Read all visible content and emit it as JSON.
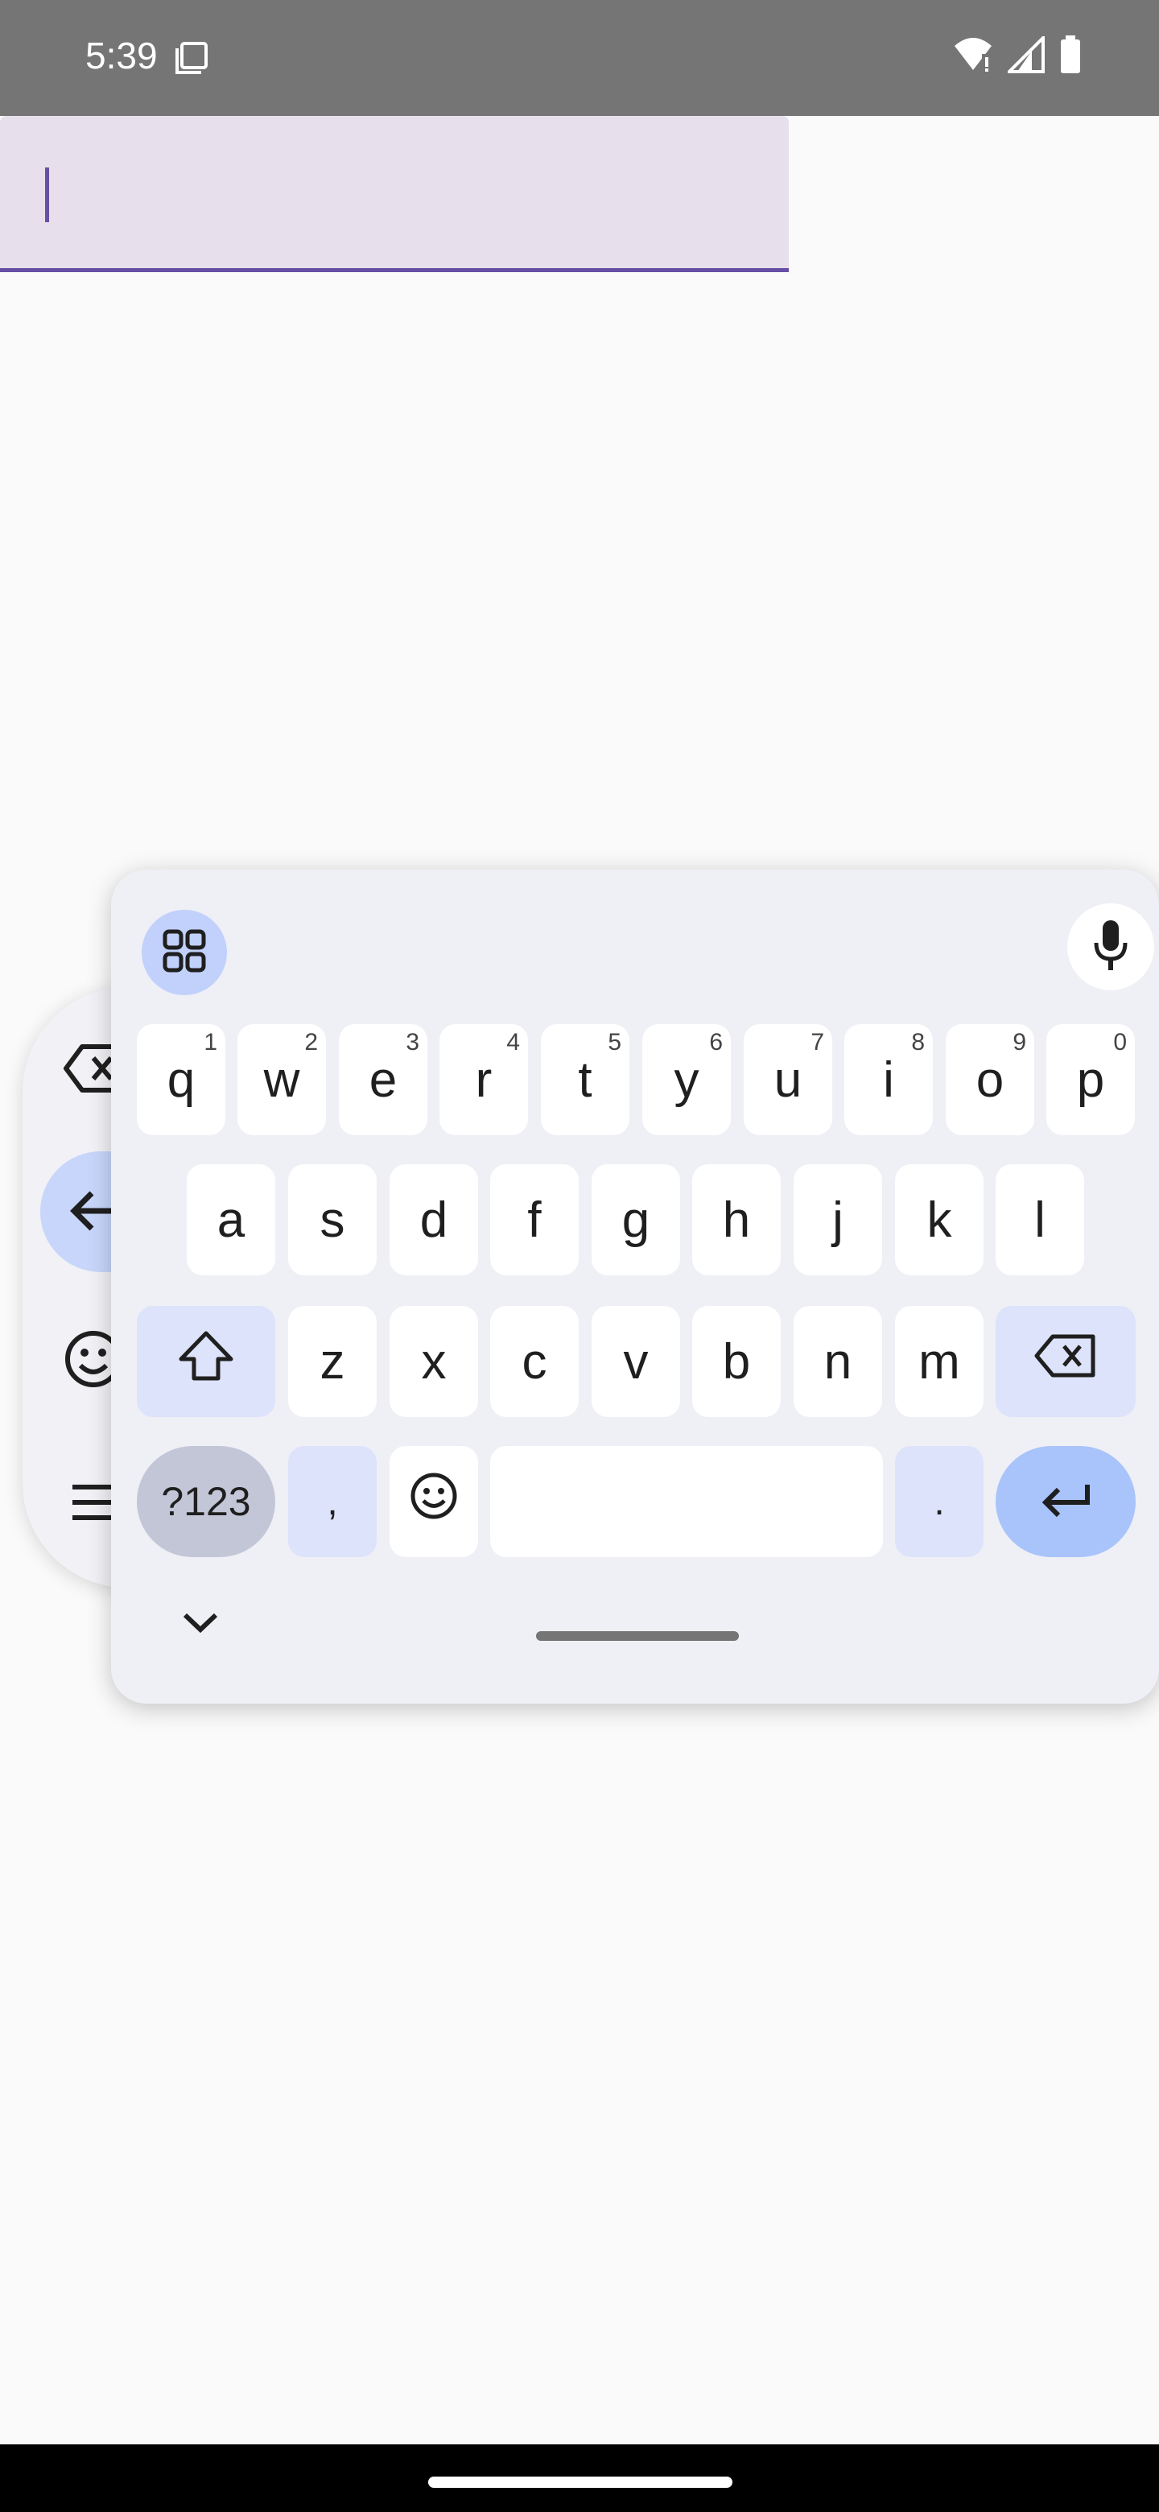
{
  "status_bar": {
    "time": "5:39",
    "icons": [
      "screenshot-icon",
      "wifi-icon",
      "signal-icon",
      "battery-icon"
    ]
  },
  "text_field": {
    "value": "",
    "focused": true
  },
  "side_panel": {
    "icons": [
      "backspace-icon",
      "arrow-left-icon",
      "emoji-icon",
      "menu-icon"
    ]
  },
  "keyboard": {
    "toolbar_icons": [
      "apps-grid-icon",
      "microphone-icon"
    ],
    "row1": [
      {
        "label": "q",
        "hint": "1"
      },
      {
        "label": "w",
        "hint": "2"
      },
      {
        "label": "e",
        "hint": "3"
      },
      {
        "label": "r",
        "hint": "4"
      },
      {
        "label": "t",
        "hint": "5"
      },
      {
        "label": "y",
        "hint": "6"
      },
      {
        "label": "u",
        "hint": "7"
      },
      {
        "label": "i",
        "hint": "8"
      },
      {
        "label": "o",
        "hint": "9"
      },
      {
        "label": "p",
        "hint": "0"
      }
    ],
    "row2": [
      "a",
      "s",
      "d",
      "f",
      "g",
      "h",
      "j",
      "k",
      "l"
    ],
    "row3": [
      "z",
      "x",
      "c",
      "v",
      "b",
      "n",
      "m"
    ],
    "symbols_label": "?123",
    "comma_label": ",",
    "period_label": ".",
    "colors": {
      "keyboard_bg": "#efeff6",
      "key_bg": "#ffffff",
      "function_key_bg": "#dde3fa",
      "enter_key_bg": "#a9c3fb",
      "accent": "#6750a4"
    }
  }
}
